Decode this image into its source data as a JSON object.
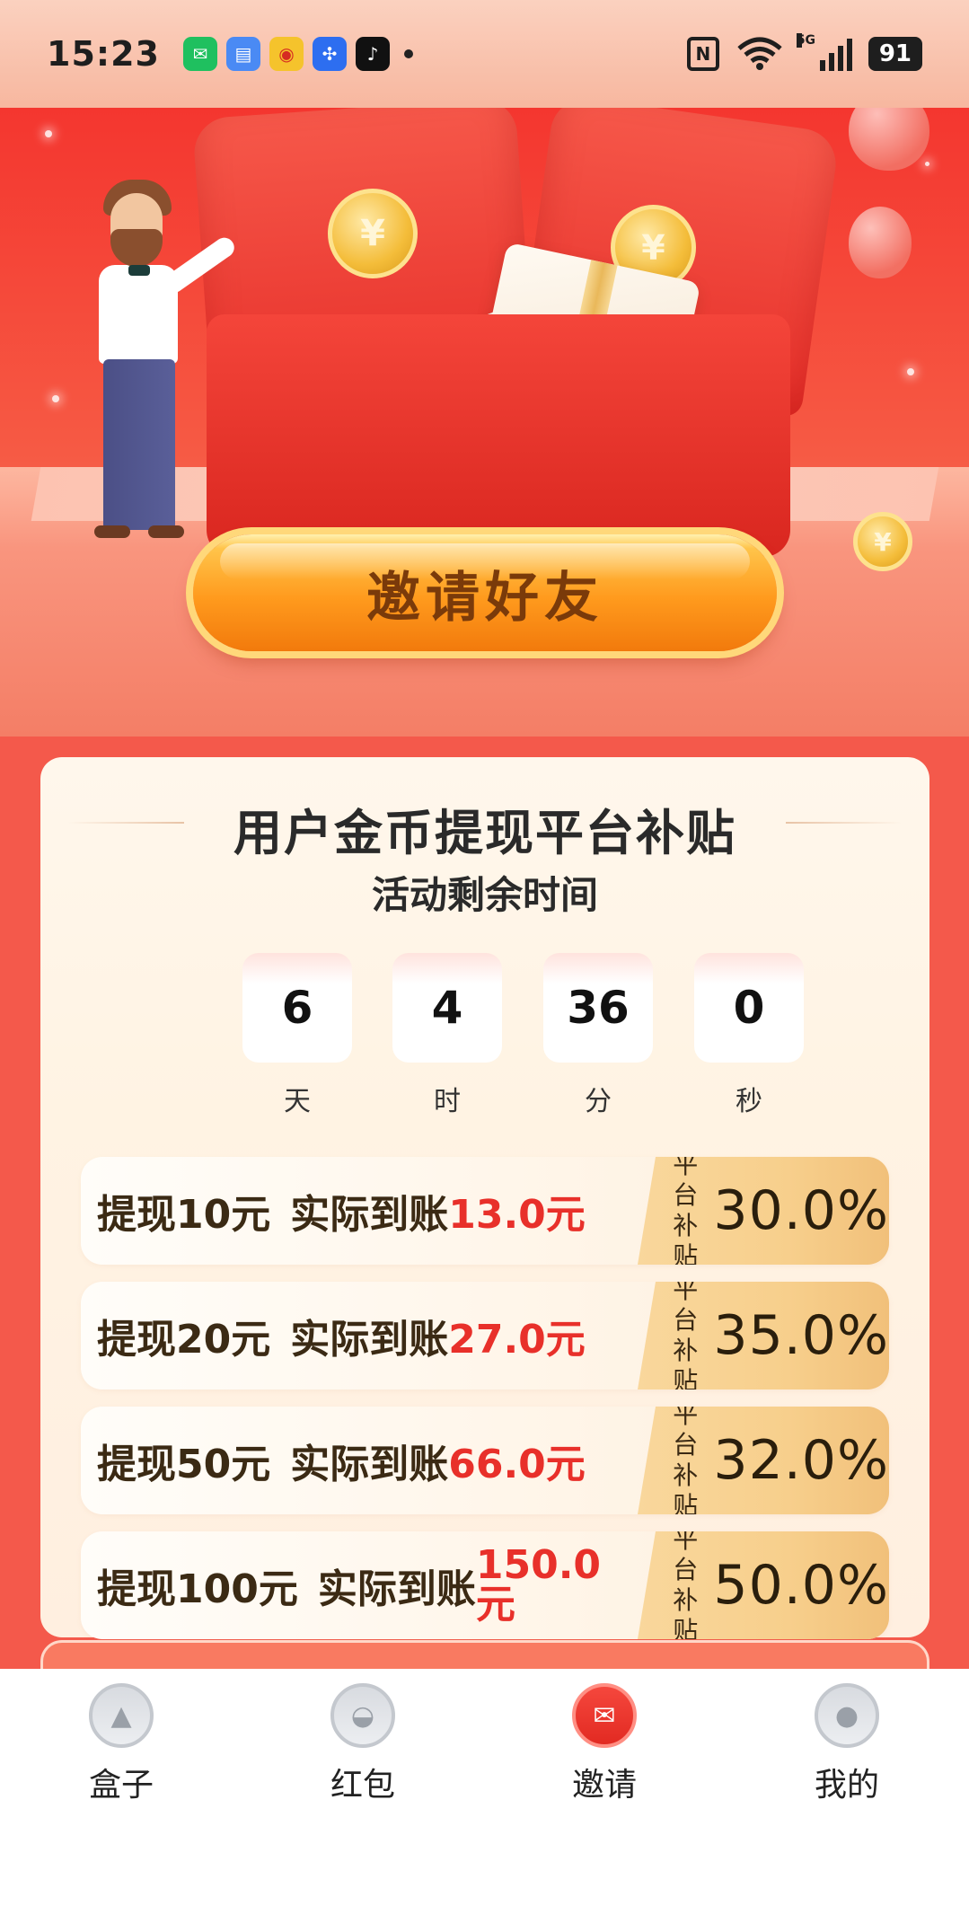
{
  "status_bar": {
    "time": "15:23",
    "notification_icons": [
      "wechat-icon",
      "message-icon",
      "weibo-icon",
      "pinwheel-icon",
      "tiktok-icon"
    ],
    "nfc": "N",
    "network": "5G",
    "battery": "91"
  },
  "hero": {
    "invite_button_label": "邀请好友"
  },
  "campaign": {
    "title": "用户金币提现平台补贴",
    "subtitle": "活动剩余时间",
    "countdown": [
      {
        "value": "6",
        "unit": "天"
      },
      {
        "value": "4",
        "unit": "时"
      },
      {
        "value": "36",
        "unit": "分"
      },
      {
        "value": "0",
        "unit": "秒"
      }
    ],
    "rows": [
      {
        "withdraw": "提现10元",
        "actual_label": "实际到账",
        "actual_value": "13.0元",
        "badge_label": "平台补贴",
        "subsidy": "30.0%"
      },
      {
        "withdraw": "提现20元",
        "actual_label": "实际到账",
        "actual_value": "27.0元",
        "badge_label": "平台补贴",
        "subsidy": "35.0%"
      },
      {
        "withdraw": "提现50元",
        "actual_label": "实际到账",
        "actual_value": "66.0元",
        "badge_label": "平台补贴",
        "subsidy": "32.0%"
      },
      {
        "withdraw": "提现100元",
        "actual_label": "实际到账",
        "actual_value": "150.0元",
        "badge_label": "平台补贴",
        "subsidy": "50.0%"
      }
    ]
  },
  "tabbar": {
    "tabs": [
      {
        "label": "盒子",
        "icon": "box-icon"
      },
      {
        "label": "红包",
        "icon": "red-packet-icon"
      },
      {
        "label": "邀请",
        "icon": "invite-icon",
        "active": true
      },
      {
        "label": "我的",
        "icon": "profile-icon"
      }
    ]
  },
  "colors": {
    "hero_red": "#f4362f",
    "highlight_red": "#e8302a",
    "badge_gold": "#f7cf8c",
    "button_orange": "#ff9a1d"
  }
}
